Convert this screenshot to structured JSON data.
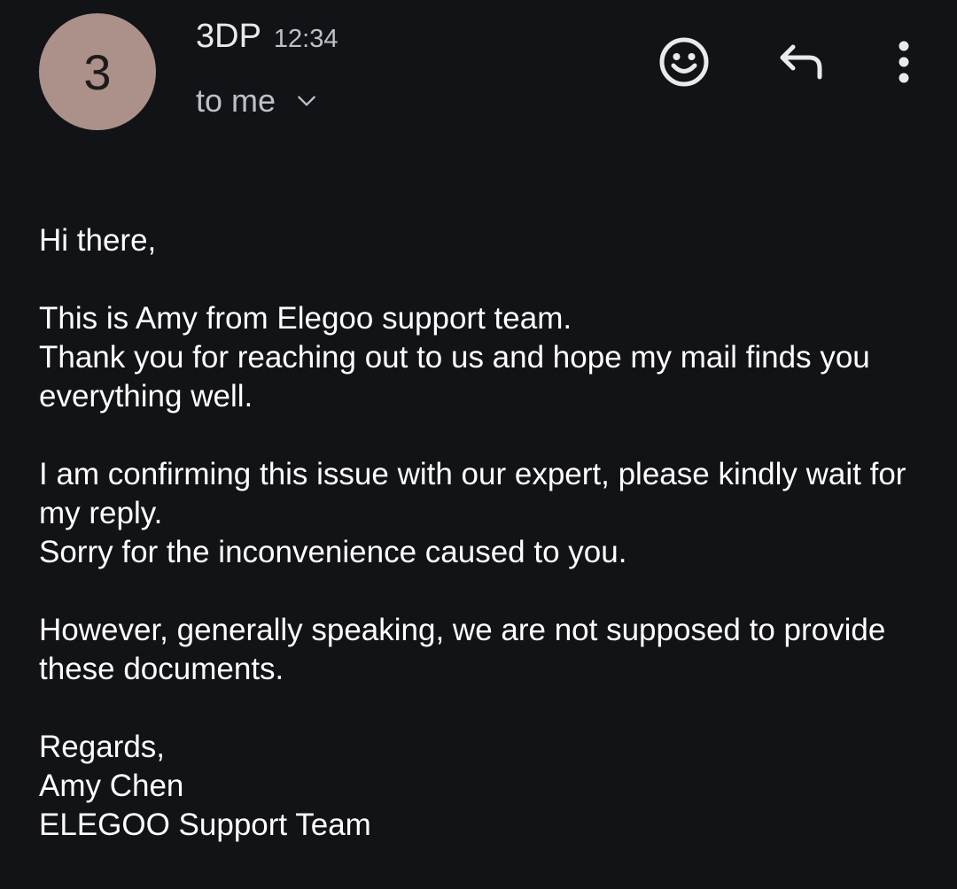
{
  "header": {
    "avatar_letter": "3",
    "avatar_color": "#ab9189",
    "sender": "3DP",
    "time": "12:34",
    "recipient": "to me",
    "icons": {
      "emoji": "add-reaction-emoji-icon",
      "reply": "reply-arrow-icon",
      "more": "more-vertical-icon",
      "chevron": "chevron-down-icon"
    }
  },
  "message": {
    "greeting": "Hi there,",
    "p1_line1": "This is Amy from Elegoo support team.",
    "p1_line2": "Thank you for reaching out to us and hope my mail finds you everything well.",
    "p2_line1": "I am confirming this issue with our expert, please kindly wait for my reply.",
    "p2_line2": "Sorry for the inconvenience caused to you.",
    "p3": "However, generally speaking, we are not supposed to provide these documents.",
    "signoff": "Regards,",
    "signature_name": "Amy Chen",
    "signature_team": "ELEGOO Support Team"
  },
  "theme": {
    "background": "#121317",
    "text": "#ffffff",
    "muted_text": "#bdc1c6"
  }
}
